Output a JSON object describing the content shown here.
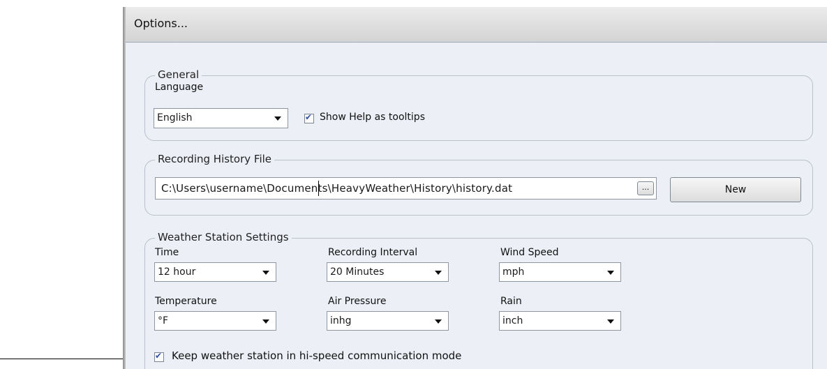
{
  "window": {
    "title": "Options..."
  },
  "general": {
    "legend": "General",
    "language_label": "Language",
    "language_value": "English",
    "show_help_label": "Show Help as tooltips",
    "show_help_checked": true
  },
  "history": {
    "legend": "Recording History File",
    "path": "C:\\Users\\username\\Documents\\HeavyWeather\\History\\history.dat",
    "browse_label": "...",
    "new_label": "New"
  },
  "station": {
    "legend": "Weather Station Settings",
    "time_label": "Time",
    "time_value": "12 hour",
    "interval_label": "Recording Interval",
    "interval_value": "20 Minutes",
    "wind_label": "Wind Speed",
    "wind_value": "mph",
    "temp_label": "Temperature",
    "temp_value": "°F",
    "pressure_label": "Air Pressure",
    "pressure_value": "inhg",
    "rain_label": "Rain",
    "rain_value": "inch",
    "hispeed_label": "Keep weather station in hi-speed communication mode",
    "hispeed_checked": true
  }
}
